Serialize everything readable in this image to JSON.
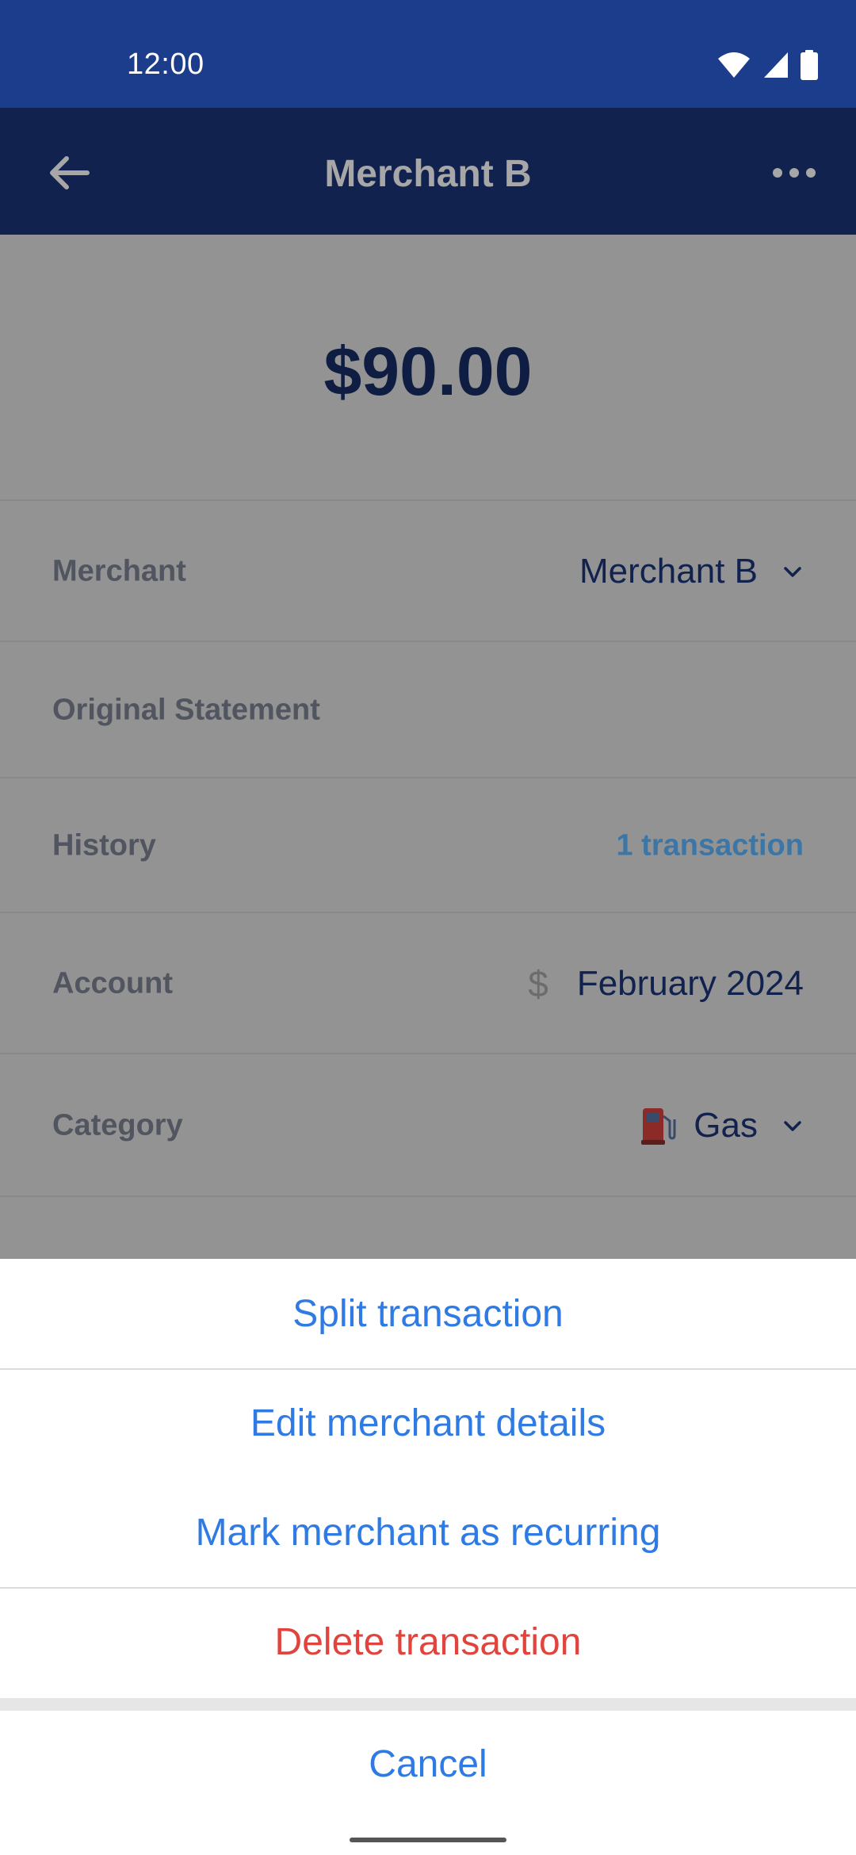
{
  "status_bar": {
    "time": "12:00",
    "icons": [
      "wifi-icon",
      "cellular-signal-icon",
      "battery-icon"
    ]
  },
  "app_bar": {
    "title": "Merchant B",
    "back_icon": "arrow-left-icon",
    "more_icon": "more-horizontal-icon"
  },
  "transaction": {
    "amount": "$90.00",
    "rows": {
      "merchant": {
        "label": "Merchant",
        "value": "Merchant B"
      },
      "original_statement": {
        "label": "Original Statement",
        "value": ""
      },
      "history": {
        "label": "History",
        "value": "1 transaction"
      },
      "account": {
        "label": "Account",
        "value": "February 2024",
        "icon_glyph": "$"
      },
      "category": {
        "label": "Category",
        "value": "Gas",
        "icon": "fuel-pump-icon"
      }
    }
  },
  "action_sheet": {
    "split": "Split transaction",
    "edit_merchant": "Edit merchant details",
    "mark_recurring": "Mark merchant as recurring",
    "delete": "Delete transaction",
    "cancel": "Cancel"
  },
  "colors": {
    "status_bar": "#1c3c8c",
    "app_bar": "#12224f",
    "scrim_content": "#939393",
    "action_blue": "#2f7be3",
    "action_red": "#e0443c",
    "link": "#3b76a6"
  }
}
